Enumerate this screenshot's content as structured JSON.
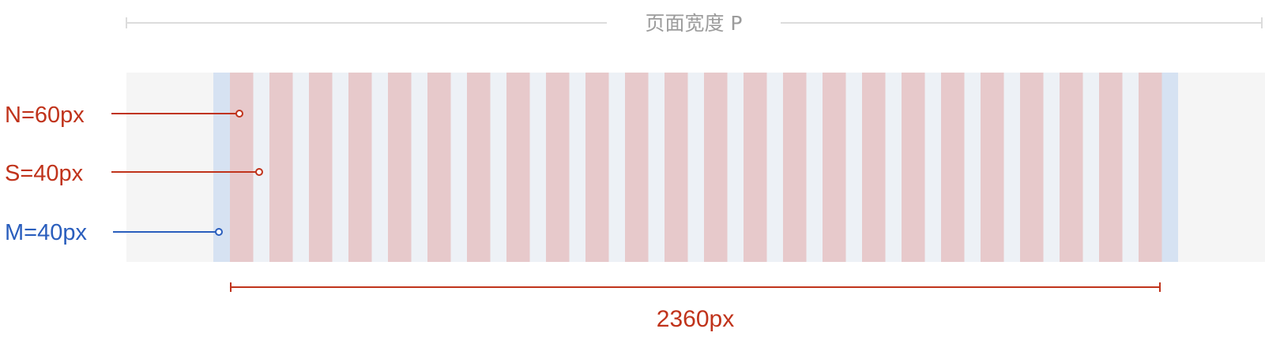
{
  "page_width": {
    "label": "页面宽度 P"
  },
  "legend": {
    "column_width": "N=60px",
    "gutter_width": "S=40px",
    "margin_width": "M=40px"
  },
  "total_width": {
    "label": "2360px"
  },
  "grid": {
    "columns": 24
  },
  "colors": {
    "page_background": "#f5f5f5",
    "content_background": "#edf1f6",
    "margin_fill": "#d6e2f2",
    "column_fill": "#e7c9cb",
    "accent_red": "#c0331b",
    "accent_blue": "#2a5ebd",
    "neutral_gray": "#9b9b9b"
  }
}
